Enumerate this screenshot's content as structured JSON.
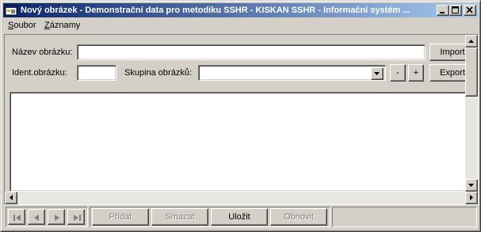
{
  "window": {
    "title": "Nový obrázek - Demonstrační data pro metodiku SSHR - KISKAN SSHR - Informační systém ..."
  },
  "menu": {
    "items": [
      {
        "label": "Soubor"
      },
      {
        "label": "Záznamy"
      }
    ]
  },
  "form": {
    "name_label": "Název obrázku:",
    "name_value": "",
    "ident_label": "Ident.obrázku:",
    "ident_value": "",
    "group_label": "Skupina obrázků:",
    "group_value": "",
    "minus_label": "-",
    "plus_label": "+",
    "import_label": "Import",
    "export_label": "Export"
  },
  "toolbar": {
    "add_label": "Přidat",
    "delete_label": "Smazat",
    "save_label": "Uložit",
    "refresh_label": "Obnovit"
  }
}
